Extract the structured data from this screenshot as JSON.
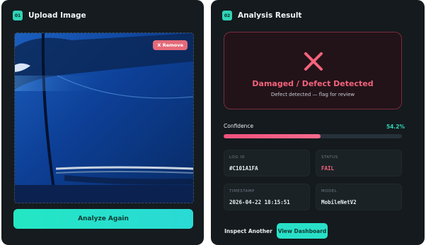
{
  "upload": {
    "badge": "01",
    "title": "Upload Image",
    "remove_label": "X Remove",
    "analyze_label": "Analyze Again"
  },
  "analysis": {
    "badge": "02",
    "title": "Analysis Result",
    "verdict": "Damaged / Defect Detected",
    "verdict_sub": "Defect detected — flag for review",
    "confidence_label": "Confidence",
    "confidence_value": "54.2%",
    "confidence_fraction": 0.542,
    "tiles": {
      "log_id": {
        "label": "LOG ID",
        "value": "#C101A1FA"
      },
      "status": {
        "label": "STATUS",
        "value": "FAIL"
      },
      "timestamp": {
        "label": "TIMESTAMP",
        "value": "2026-04-22 18:15:51"
      },
      "model": {
        "label": "MODEL",
        "value": "MobileNetV2"
      }
    },
    "inspect_label": "Inspect Another",
    "dashboard_label": "View Dashboard"
  },
  "colors": {
    "accent": "#2fd4b6",
    "danger": "#f4637b",
    "panel": "#151b1e"
  },
  "icons": {
    "verdict_icon": "x-icon"
  }
}
